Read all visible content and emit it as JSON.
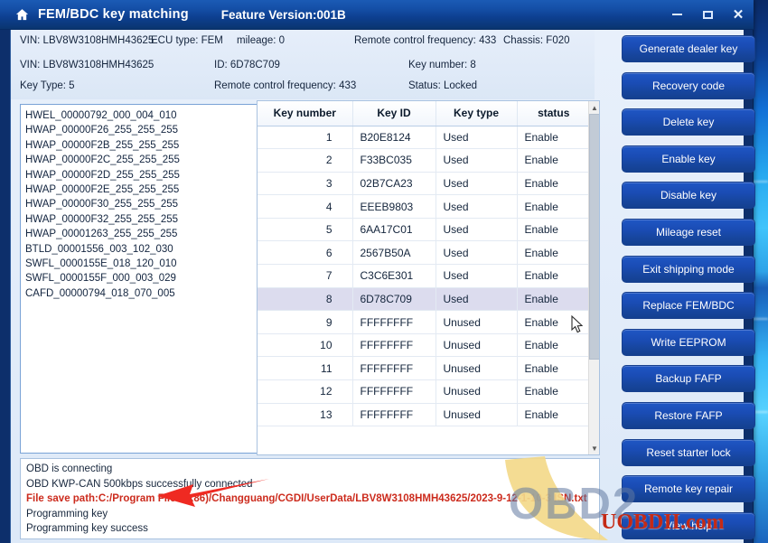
{
  "window": {
    "home_icon": "home-icon",
    "title": "FEM/BDC key matching",
    "feature_version": "Feature Version:001B",
    "controls": {
      "minimize": "minimize-icon",
      "maximize": "maximize-icon",
      "close": "close-icon"
    }
  },
  "info": {
    "line1": {
      "vin": "VIN: LBV8W3108HMH43625",
      "ecu_type": "ECU type: FEM",
      "mileage": "mileage: 0",
      "remote_freq": "Remote control frequency: 433",
      "chassis": "Chassis: F020"
    },
    "line2": {
      "vin": "VIN: LBV8W3108HMH43625",
      "id": "ID: 6D78C709",
      "key_number": "Key number: 8"
    },
    "line3": {
      "key_type": "Key Type: 5",
      "remote_freq": "Remote control frequency: 433",
      "status": "Status: Locked"
    }
  },
  "ecu_list": [
    "HWEL_00000792_000_004_010",
    "HWAP_00000F26_255_255_255",
    "HWAP_00000F2B_255_255_255",
    "HWAP_00000F2C_255_255_255",
    "HWAP_00000F2D_255_255_255",
    "HWAP_00000F2E_255_255_255",
    "HWAP_00000F30_255_255_255",
    "HWAP_00000F32_255_255_255",
    "HWAP_00001263_255_255_255",
    "BTLD_00001556_003_102_030",
    "SWFL_0000155E_018_120_010",
    "SWFL_0000155F_000_003_029",
    "CAFD_00000794_018_070_005"
  ],
  "key_table": {
    "columns": [
      "Key number",
      "Key ID",
      "Key type",
      "status"
    ],
    "selected_row_index": 7,
    "rows": [
      {
        "number": "1",
        "id": "B20E8124",
        "type": "Used",
        "status": "Enable"
      },
      {
        "number": "2",
        "id": "F33BC035",
        "type": "Used",
        "status": "Enable"
      },
      {
        "number": "3",
        "id": "02B7CA23",
        "type": "Used",
        "status": "Enable"
      },
      {
        "number": "4",
        "id": "EEEB9803",
        "type": "Used",
        "status": "Enable"
      },
      {
        "number": "5",
        "id": "6AA17C01",
        "type": "Used",
        "status": "Enable"
      },
      {
        "number": "6",
        "id": "2567B50A",
        "type": "Used",
        "status": "Enable"
      },
      {
        "number": "7",
        "id": "C3C6E301",
        "type": "Used",
        "status": "Enable"
      },
      {
        "number": "8",
        "id": "6D78C709",
        "type": "Used",
        "status": "Enable"
      },
      {
        "number": "9",
        "id": "FFFFFFFF",
        "type": "Unused",
        "status": "Enable"
      },
      {
        "number": "10",
        "id": "FFFFFFFF",
        "type": "Unused",
        "status": "Enable"
      },
      {
        "number": "11",
        "id": "FFFFFFFF",
        "type": "Unused",
        "status": "Enable"
      },
      {
        "number": "12",
        "id": "FFFFFFFF",
        "type": "Unused",
        "status": "Enable"
      },
      {
        "number": "13",
        "id": "FFFFFFFF",
        "type": "Unused",
        "status": "Enable"
      }
    ],
    "scroll_up_icon": "chevron-up-icon",
    "scroll_down_icon": "chevron-down-icon"
  },
  "log": [
    {
      "text": "OBD is connecting",
      "error": false
    },
    {
      "text": "OBD KWP-CAN 500kbps successfully connected",
      "error": false
    },
    {
      "text": "File save path:C:/Program Files (x86)/Changguang/CGDI/UserData/LBV8W3108HMH43625/2023-9-12-1-10-3 ISN.txt",
      "error": true
    },
    {
      "text": "Programming key",
      "error": false
    },
    {
      "text": "Programming key success",
      "error": false
    }
  ],
  "buttons": [
    "Generate dealer key",
    "Recovery code",
    "Delete key",
    "Enable key",
    "Disable key",
    "Mileage reset",
    "Exit shipping mode",
    "Replace FEM/BDC",
    "Write EEPROM",
    "Backup FAFP",
    "Restore FAFP",
    "Reset starter lock",
    "Remote key repair",
    "View help"
  ],
  "watermark": {
    "primary": "OBD2",
    "secondary": "UOBDII.com"
  },
  "colors": {
    "title_bar": "#1550a8",
    "button": "#1a4cb4",
    "error_text": "#cc2b1d",
    "selected_row": "#dcdcee",
    "watermark_red": "#c42a16"
  }
}
